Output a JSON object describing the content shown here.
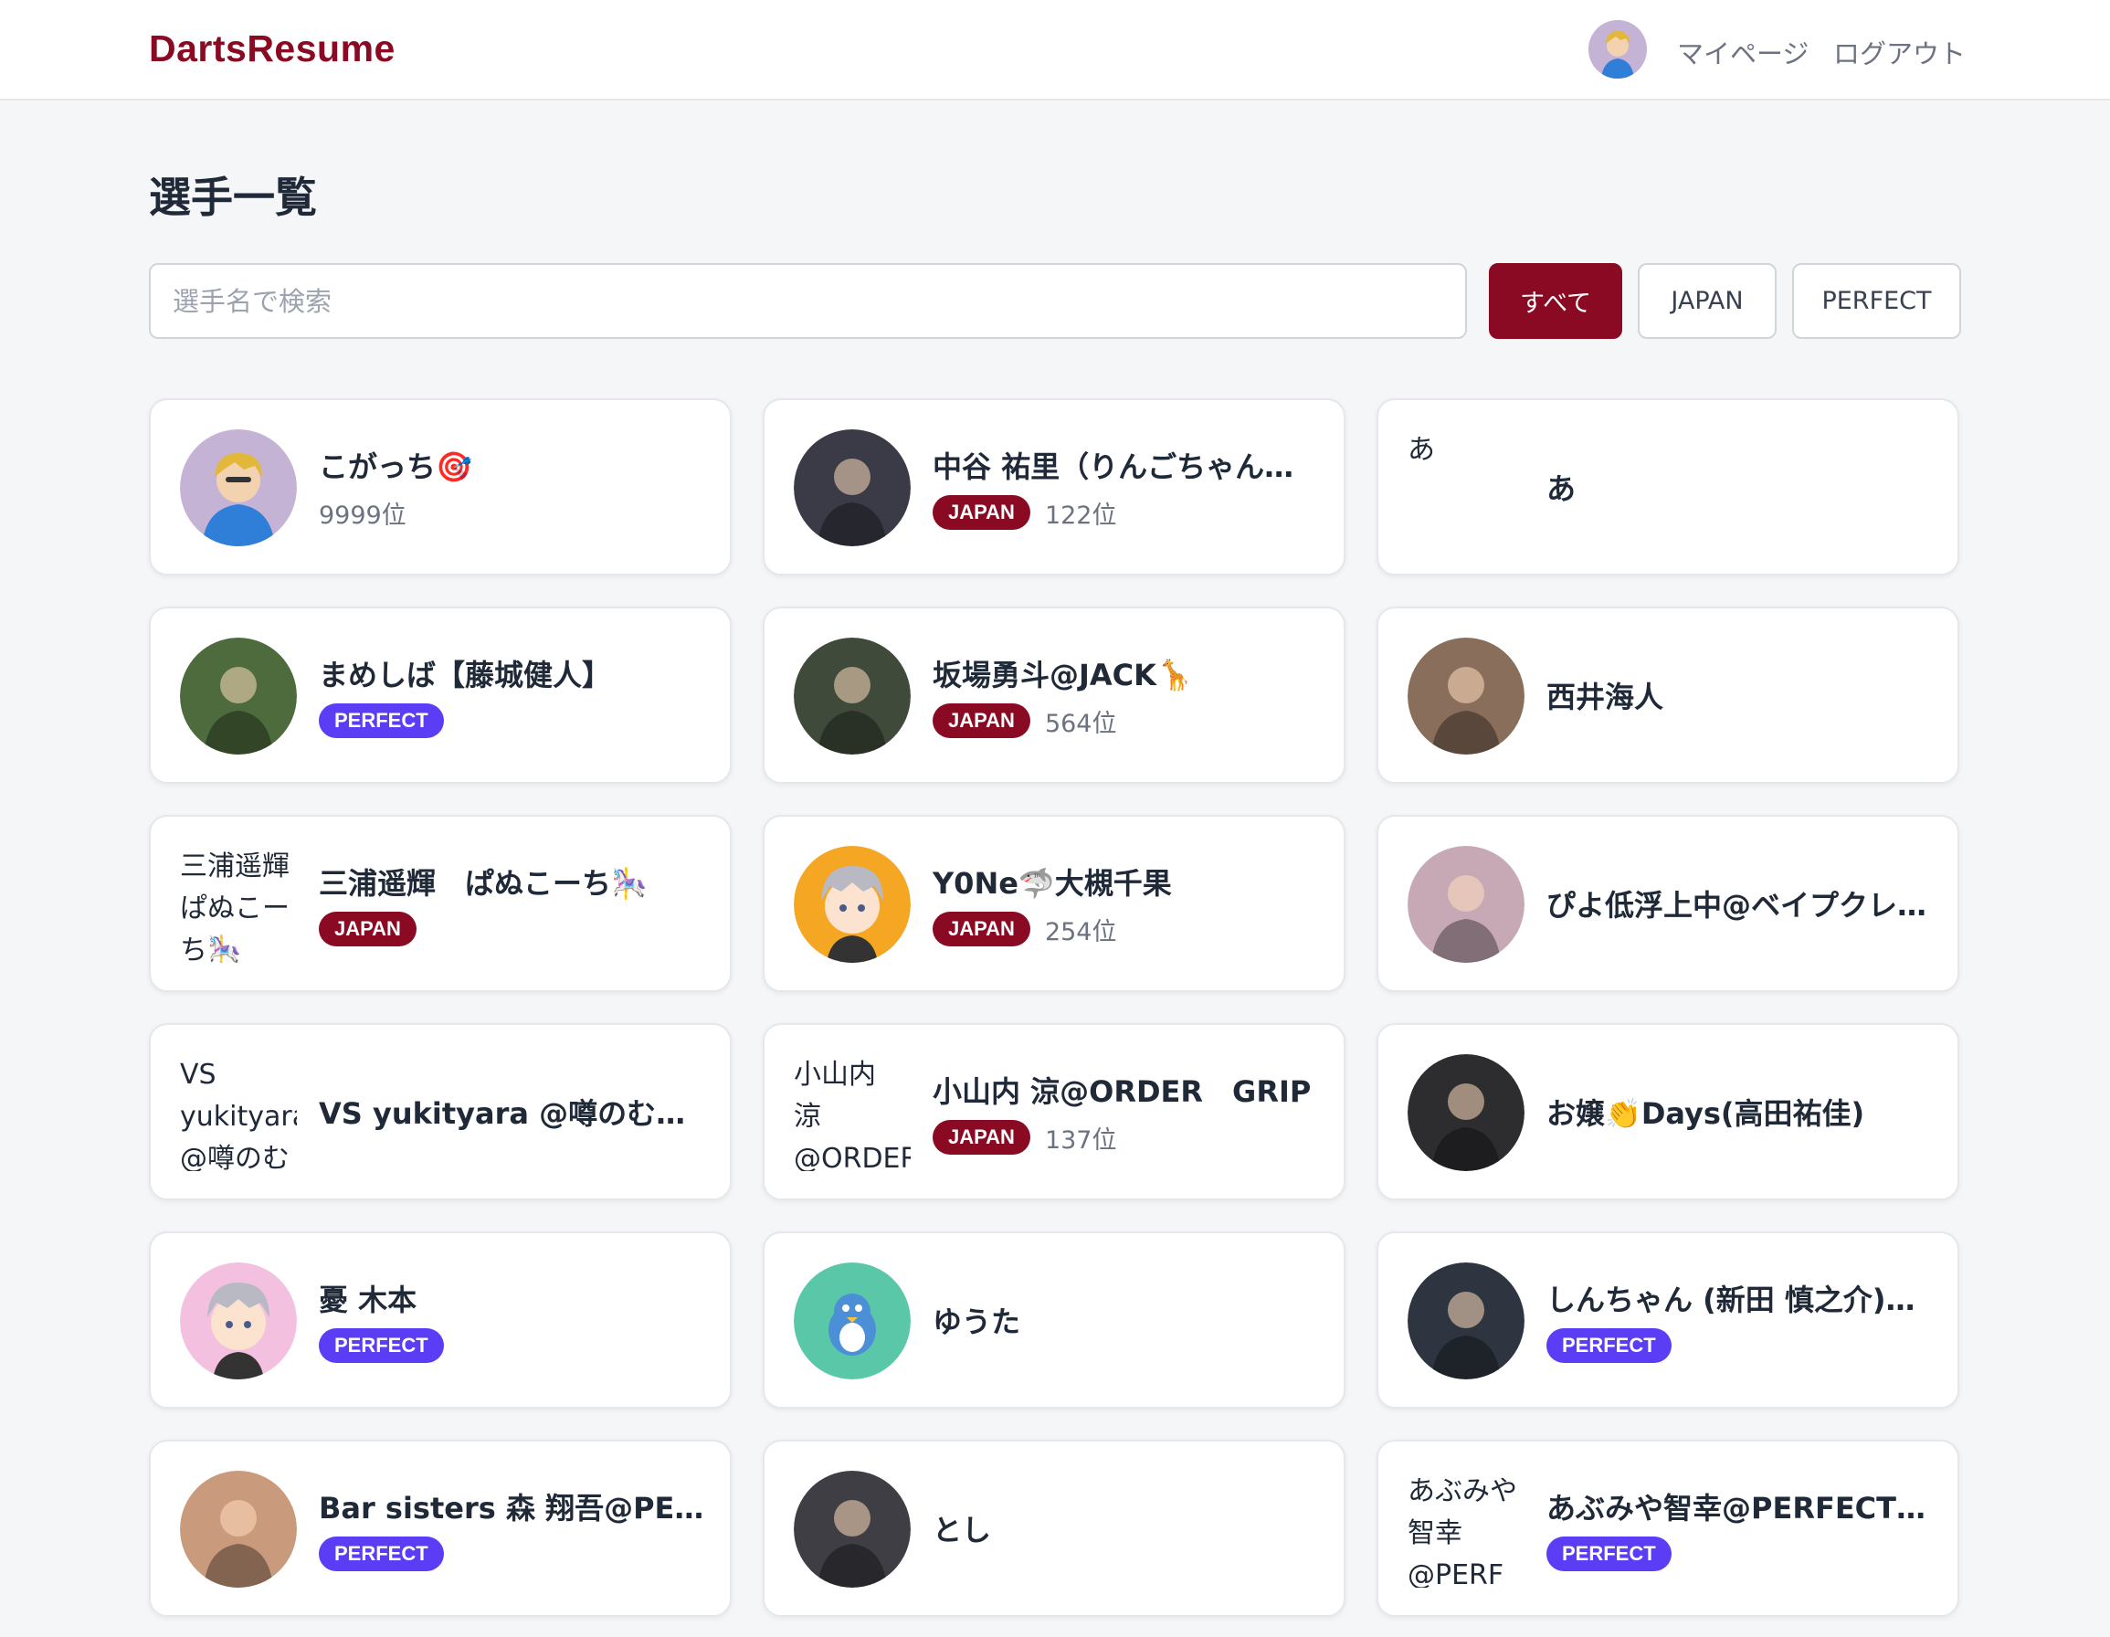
{
  "header": {
    "logo": "DartsResume",
    "mypage_label": "マイページ",
    "logout_label": "ログアウト"
  },
  "page": {
    "title": "選手一覧"
  },
  "search": {
    "placeholder": "選手名で検索",
    "value": ""
  },
  "filters": [
    {
      "label": "すべて",
      "active": true
    },
    {
      "label": "JAPAN",
      "active": false
    },
    {
      "label": "PERFECT",
      "active": false
    }
  ],
  "colors": {
    "brand": "#8b0a23",
    "perfect": "#5b3df5"
  },
  "players": [
    {
      "name": "こがっち🎯",
      "badge": "",
      "rank": "9999位",
      "avatar": "cartoon-man",
      "avatar_color": "#c5b3d6"
    },
    {
      "name": "中谷 祐里（りんごちゃん…",
      "badge": "JAPAN",
      "rank": "122位",
      "avatar": "photo",
      "avatar_color": "#3b3b47"
    },
    {
      "name": "あ",
      "badge": "",
      "rank": "",
      "avatar": "broken",
      "avatar_alt": "あ"
    },
    {
      "name": "まめしば【藤城健人】",
      "badge": "PERFECT",
      "rank": "",
      "avatar": "photo",
      "avatar_color": "#4d6b3c"
    },
    {
      "name": "坂場勇斗@JACK🦒",
      "badge": "JAPAN",
      "rank": "564位",
      "avatar": "photo",
      "avatar_color": "#3f4a3a"
    },
    {
      "name": "西井海人",
      "badge": "",
      "rank": "",
      "avatar": "photo",
      "avatar_color": "#8a6e5c"
    },
    {
      "name": "三浦遥輝　ぱぬこーち🎠",
      "badge": "JAPAN",
      "rank": "",
      "avatar": "broken",
      "avatar_alt": "三浦遥輝　ぱぬこーち🎠"
    },
    {
      "name": "Y0Ne🦈大槻千果",
      "badge": "JAPAN",
      "rank": "254位",
      "avatar": "anime",
      "avatar_color": "#f5a623"
    },
    {
      "name": "ぴよ低浮上中@ベイプクレ…",
      "badge": "",
      "rank": "",
      "avatar": "photo",
      "avatar_color": "#c7a9b5"
    },
    {
      "name": "VS yukityara @噂のむっ…",
      "badge": "",
      "rank": "",
      "avatar": "broken",
      "avatar_alt": "VS yukityara @噂のむっ"
    },
    {
      "name": "小山内 涼@ORDER　GRIP",
      "badge": "JAPAN",
      "rank": "137位",
      "avatar": "broken",
      "avatar_alt": "小山内 涼@ORDER"
    },
    {
      "name": "お嬢👏Days(高田祐佳)",
      "badge": "",
      "rank": "",
      "avatar": "photo",
      "avatar_color": "#2d2d30"
    },
    {
      "name": "憂 木本",
      "badge": "PERFECT",
      "rank": "",
      "avatar": "anime",
      "avatar_color": "#f3c0e0"
    },
    {
      "name": "ゆうた",
      "badge": "",
      "rank": "",
      "avatar": "bird",
      "avatar_color": "#5ac8a8"
    },
    {
      "name": "しんちゃん (新田 慎之介)…",
      "badge": "PERFECT",
      "rank": "",
      "avatar": "photo",
      "avatar_color": "#2f3540"
    },
    {
      "name": "Bar sisters 森 翔吾@PERF…",
      "badge": "PERFECT",
      "rank": "",
      "avatar": "photo",
      "avatar_color": "#c99a7b"
    },
    {
      "name": "とし",
      "badge": "",
      "rank": "",
      "avatar": "photo",
      "avatar_color": "#3e3e44"
    },
    {
      "name": "あぶみや智幸@PERFECTP…",
      "badge": "PERFECT",
      "rank": "",
      "avatar": "broken",
      "avatar_alt": "あぶみや智幸@PERF"
    }
  ]
}
